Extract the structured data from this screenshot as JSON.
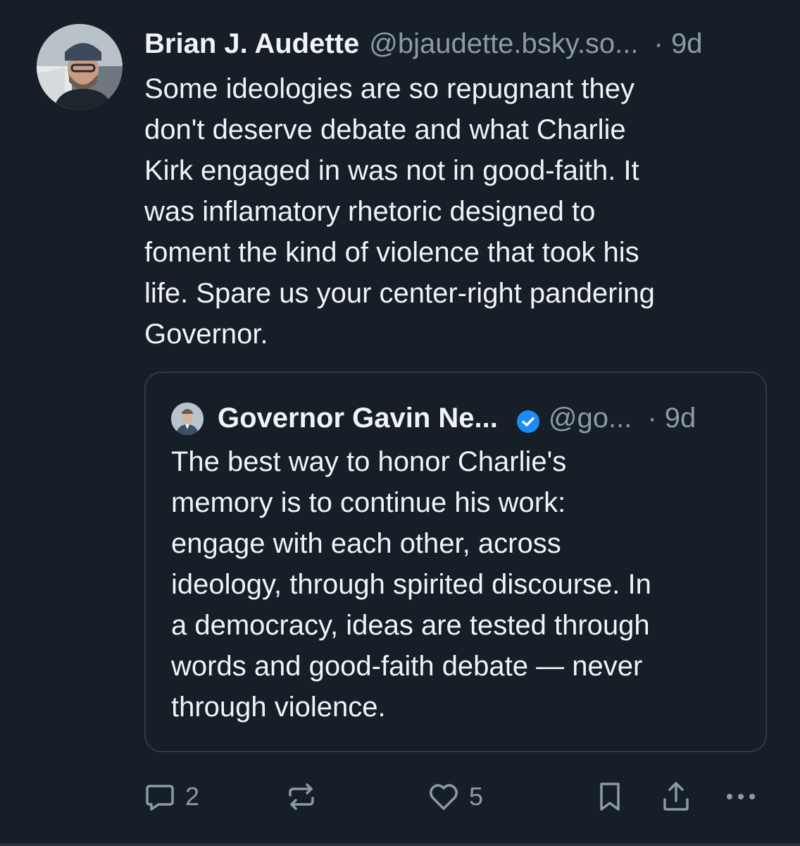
{
  "post": {
    "display_name": "Brian J. Audette",
    "handle": "@bjaudette.bsky.so...",
    "time": "· 9d",
    "avatar_icon": "user-avatar-photo",
    "text_lines": [
      "Some ideologies are so repugnant they",
      "don't deserve debate and what Charlie",
      "Kirk engaged in was not in good-faith. It",
      "was inflamatory rhetoric designed to",
      "foment the kind of violence that took his",
      "life. Spare us your center-right pandering",
      "Governor."
    ]
  },
  "quote": {
    "display_name": "Governor Gavin Ne...",
    "verified_icon": "verified-check-icon",
    "handle": "@go...",
    "time": "· 9d",
    "text_lines": [
      "The best way to honor Charlie's",
      "memory is to continue his work:",
      "engage with each other, across",
      "ideology, through spirited discourse. In",
      "a democracy, ideas are tested through",
      "words and good-faith debate — never",
      "through violence."
    ]
  },
  "actions": {
    "reply_count": "2",
    "like_count": "5",
    "icons": [
      "reply-icon",
      "repost-icon",
      "like-icon",
      "bookmark-icon",
      "share-icon",
      "more-icon"
    ]
  },
  "colors": {
    "background": "#161e27",
    "text": "#f1f3f5",
    "muted": "#8c9aa8",
    "verified": "#1d8cf8",
    "border": "#2f3a46"
  }
}
